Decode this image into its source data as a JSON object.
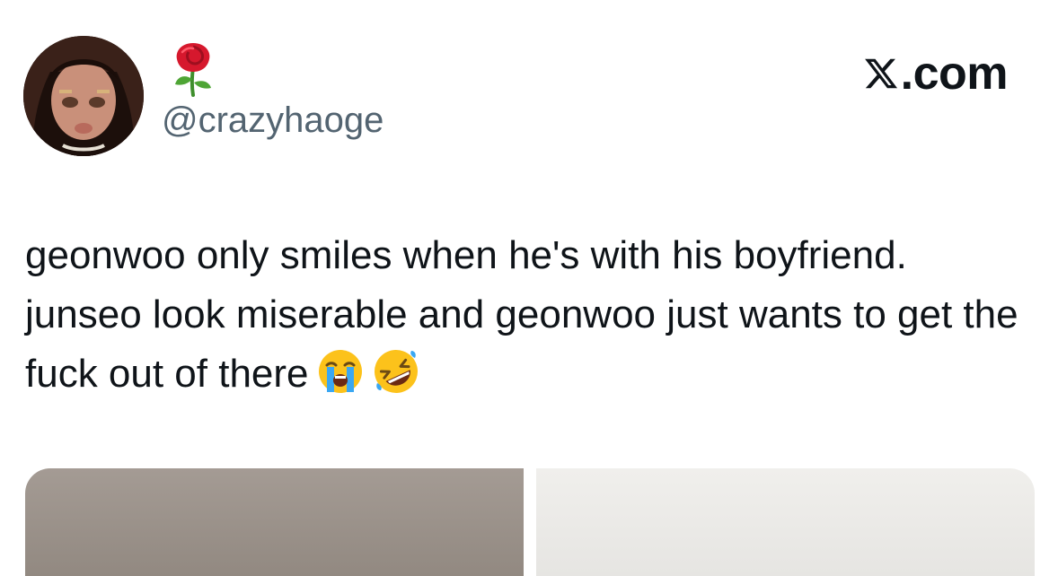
{
  "tweet": {
    "display_name_icon": "rose-emoji",
    "handle": "@crazyhaoge",
    "brand": {
      "icon": "x-logo-icon",
      "suffix": ".com"
    },
    "text": "geonwoo only smiles when he's with his boyfriend. junseo look miserable and geonwoo just wants to get the fuck out of there",
    "text_emojis": [
      "loudly-crying-face-emoji",
      "rolling-on-the-floor-laughing-emoji"
    ],
    "media": [
      {
        "name": "media-image-1"
      },
      {
        "name": "media-image-2"
      }
    ]
  },
  "colors": {
    "text": "#0f1419",
    "secondary_text": "#536471",
    "background": "#ffffff"
  }
}
